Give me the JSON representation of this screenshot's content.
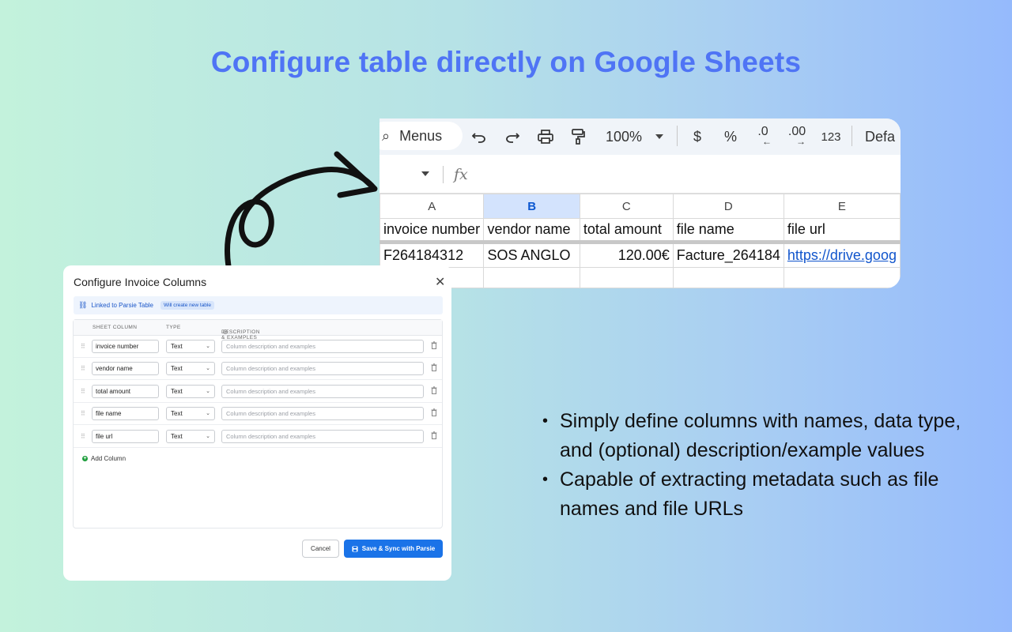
{
  "headline": "Configure table directly on Google Sheets",
  "sheet": {
    "toolbar": {
      "menus_label": "Menus",
      "zoom": "100%",
      "currency": "$",
      "percent": "%",
      "decrease_decimal": ".0",
      "increase_decimal": ".00",
      "number_format": "123",
      "font_truncated": "Defa"
    },
    "formula_bar": {
      "fx": "fx"
    },
    "column_letters": [
      "A",
      "B",
      "C",
      "D",
      "E"
    ],
    "selected_column": "B",
    "header_row": [
      "invoice number",
      "vendor name",
      "total amount",
      "file name",
      "file url"
    ],
    "data_row": [
      "F264184312",
      "SOS ANGLO",
      "120.00€",
      "Facture_264184",
      "https://drive.goog"
    ]
  },
  "dialog": {
    "title": "Configure Invoice Columns",
    "linked_label": "Linked to Parsie Table",
    "linked_badge": "Will create new table",
    "headers": {
      "sheet_column": "SHEET COLUMN",
      "type": "TYPE",
      "description": "DESCRIPTION & EXAMPLES"
    },
    "rows": [
      {
        "name": "invoice number",
        "type": "Text",
        "placeholder": "Column description and examples"
      },
      {
        "name": "vendor name",
        "type": "Text",
        "placeholder": "Column description and examples"
      },
      {
        "name": "total amount",
        "type": "Text",
        "placeholder": "Column description and examples"
      },
      {
        "name": "file name",
        "type": "Text",
        "placeholder": "Column description and examples"
      },
      {
        "name": "file url",
        "type": "Text",
        "placeholder": "Column description and examples"
      }
    ],
    "add_column": "Add Column",
    "cancel": "Cancel",
    "save": "Save & Sync with Parsie"
  },
  "bullets": [
    "Simply define columns with names, data type, and (optional) description/example values",
    "Capable of extracting metadata such as file names and file URLs"
  ],
  "colors": {
    "headline": "#4f74f5",
    "primary_button": "#1a73e8",
    "selected_col": "#d3e3fd",
    "link": "#1155cc"
  }
}
